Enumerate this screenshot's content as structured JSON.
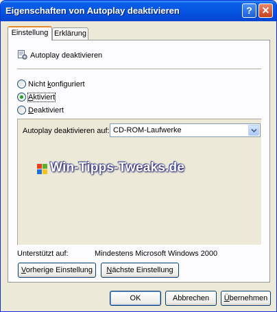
{
  "window": {
    "title": "Eigenschaften von Autoplay deaktivieren",
    "help_glyph": "?",
    "close_glyph": "✕",
    "accent_color": "#0554E1"
  },
  "tabs": [
    {
      "label": "Einstellung",
      "active": true
    },
    {
      "label": "Erklärung",
      "active": false
    }
  ],
  "policy": {
    "name": "Autoplay deaktivieren",
    "icon": "policy-setting-icon"
  },
  "state_options": [
    {
      "prefix": "Nicht ",
      "underlined": "k",
      "suffix": "onfiguriert",
      "checked": false
    },
    {
      "prefix": "",
      "underlined": "A",
      "suffix": "ktiviert",
      "checked": true
    },
    {
      "prefix": "",
      "underlined": "D",
      "suffix": "eaktiviert",
      "checked": false
    }
  ],
  "options": {
    "label": "Autoplay deaktivieren auf:",
    "select_value": "CD-ROM-Laufwerke"
  },
  "watermark": {
    "text": "Win-Tipps-Tweaks.de"
  },
  "supported": {
    "label": "Unterstützt auf:",
    "value": "Mindestens Microsoft Windows 2000"
  },
  "nav_buttons": {
    "prev": {
      "underlined": "V",
      "rest": "orherige Einstellung"
    },
    "next": {
      "underlined": "N",
      "rest": "ächste Einstellung"
    }
  },
  "dialog_buttons": {
    "ok": "OK",
    "cancel": "Abbrechen",
    "apply": {
      "underlined": "Ü",
      "rest": "bernehmen"
    }
  }
}
